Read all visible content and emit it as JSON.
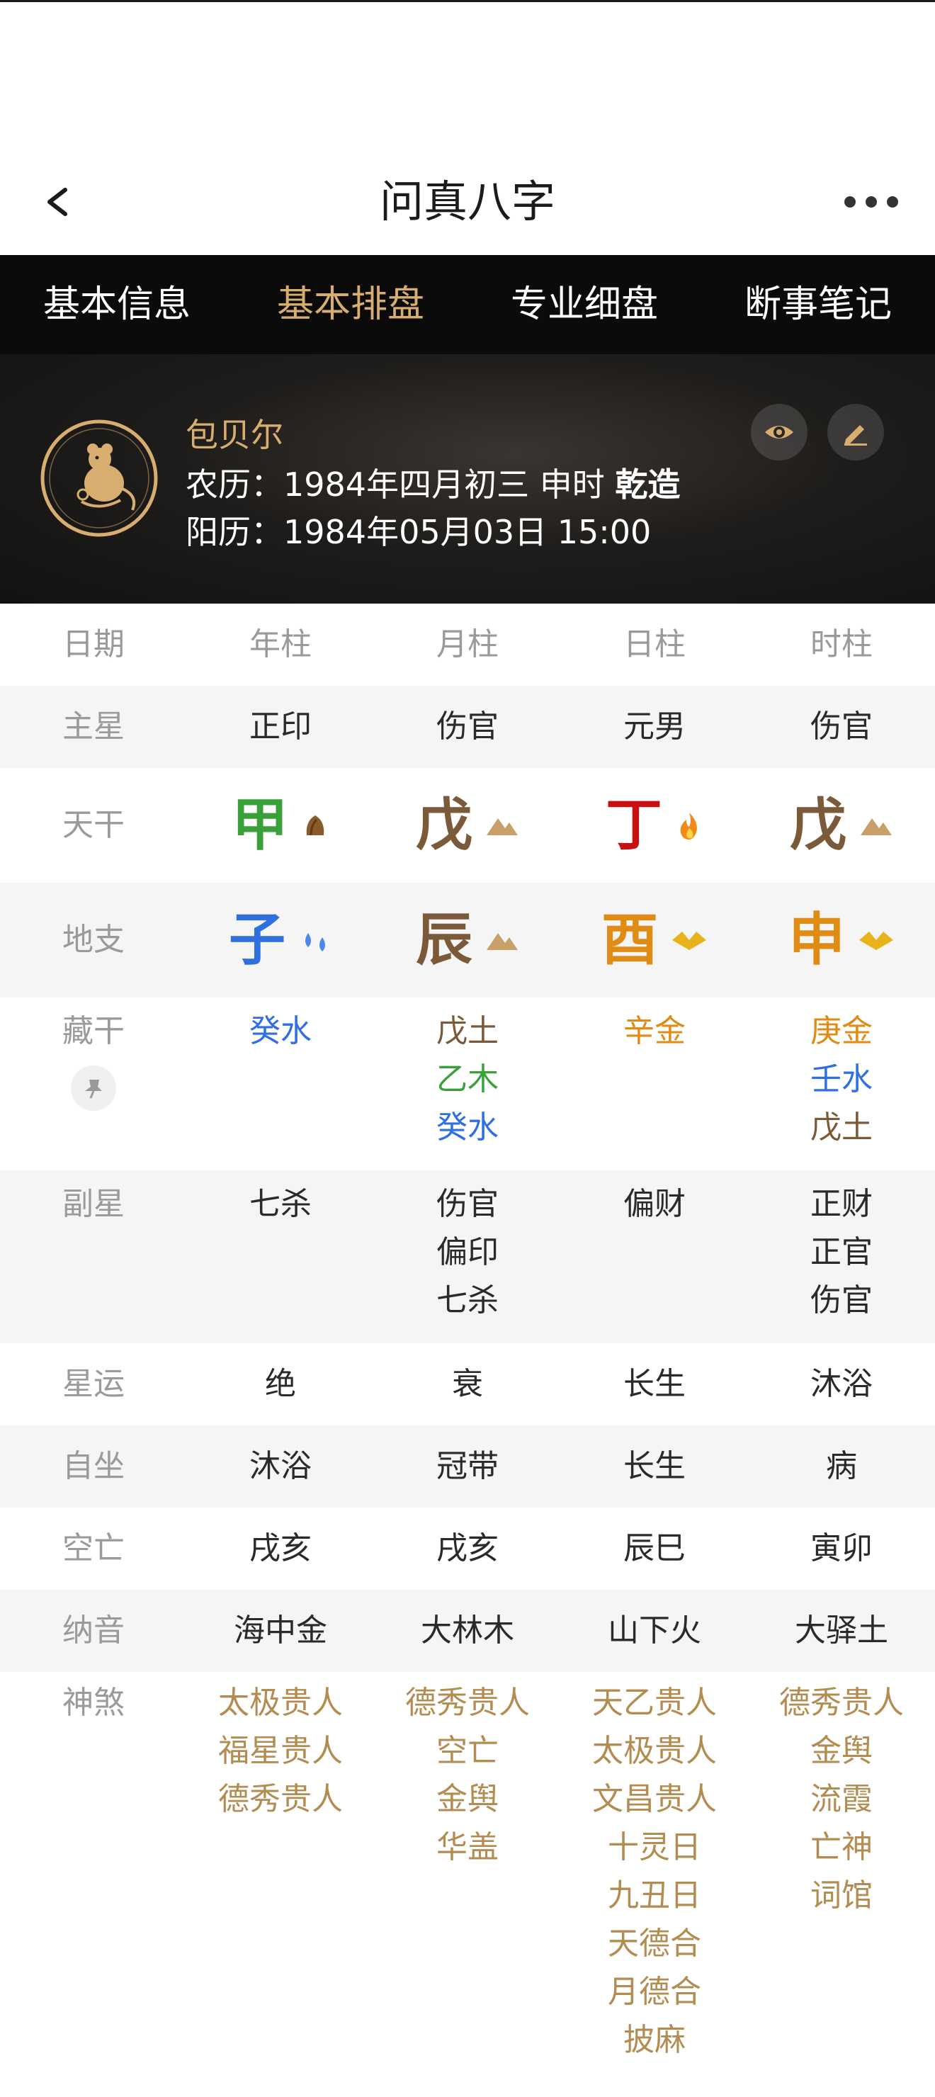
{
  "app": {
    "title": "问真八字"
  },
  "tabs": [
    {
      "label": "基本信息",
      "active": false
    },
    {
      "label": "基本排盘",
      "active": true
    },
    {
      "label": "专业细盘",
      "active": false
    },
    {
      "label": "断事笔记",
      "active": false
    }
  ],
  "profile": {
    "name": "包贝尔",
    "lunar_prefix": "农历：1984年四月初三 申时",
    "lunar_gender": "乾造",
    "solar": "阳历：1984年05月03日 15:00"
  },
  "table": {
    "headers": [
      "日期",
      "年柱",
      "月柱",
      "日柱",
      "时柱"
    ],
    "main_star": {
      "label": "主星",
      "values": [
        "正印",
        "伤官",
        "元男",
        "伤官"
      ]
    },
    "tiangan": {
      "label": "天干",
      "values": [
        {
          "char": "甲",
          "color": "#3aa13a",
          "element": "wood"
        },
        {
          "char": "戊",
          "color": "#7a5a38",
          "element": "earth"
        },
        {
          "char": "丁",
          "color": "#c81010",
          "element": "fire"
        },
        {
          "char": "戊",
          "color": "#7a5a38",
          "element": "earth"
        }
      ]
    },
    "dizhi": {
      "label": "地支",
      "values": [
        {
          "char": "子",
          "color": "#2f6fe0",
          "element": "water"
        },
        {
          "char": "辰",
          "color": "#7a5a38",
          "element": "earth"
        },
        {
          "char": "酉",
          "color": "#e08c14",
          "element": "metal"
        },
        {
          "char": "申",
          "color": "#e08c14",
          "element": "metal"
        }
      ]
    },
    "canggan": {
      "label": "藏干",
      "values": [
        [
          {
            "t": "癸水",
            "color": "#2f6fe0"
          }
        ],
        [
          {
            "t": "戊土",
            "color": "#7a5a38"
          },
          {
            "t": "乙木",
            "color": "#3aa13a"
          },
          {
            "t": "癸水",
            "color": "#2f6fe0"
          }
        ],
        [
          {
            "t": "辛金",
            "color": "#e08c14"
          }
        ],
        [
          {
            "t": "庚金",
            "color": "#e08c14"
          },
          {
            "t": "壬水",
            "color": "#2f6fe0"
          },
          {
            "t": "戊土",
            "color": "#7a5a38"
          }
        ]
      ]
    },
    "fuxing": {
      "label": "副星",
      "values": [
        [
          "七杀"
        ],
        [
          "伤官",
          "偏印",
          "七杀"
        ],
        [
          "偏财"
        ],
        [
          "正财",
          "正官",
          "伤官"
        ]
      ]
    },
    "xingyun": {
      "label": "星运",
      "values": [
        "绝",
        "衰",
        "长生",
        "沐浴"
      ]
    },
    "zizuo": {
      "label": "自坐",
      "values": [
        "沐浴",
        "冠带",
        "长生",
        "病"
      ]
    },
    "kongwang": {
      "label": "空亡",
      "values": [
        "戌亥",
        "戌亥",
        "辰巳",
        "寅卯"
      ]
    },
    "nayin": {
      "label": "纳音",
      "values": [
        "海中金",
        "大林木",
        "山下火",
        "大驿土"
      ]
    },
    "shensha": {
      "label": "神煞",
      "values": [
        [
          "太极贵人",
          "福星贵人",
          "德秀贵人"
        ],
        [
          "德秀贵人",
          "空亡",
          "金舆",
          "华盖"
        ],
        [
          "天乙贵人",
          "太极贵人",
          "文昌贵人",
          "十灵日",
          "九丑日",
          "天德合",
          "月德合",
          "披麻"
        ],
        [
          "德秀贵人",
          "金舆",
          "流霞",
          "亡神",
          "词馆"
        ]
      ]
    }
  },
  "colors": {
    "accent": "#d7ae6f",
    "tab_bg": "#0b0b0b",
    "shensha": "#b38c52"
  }
}
